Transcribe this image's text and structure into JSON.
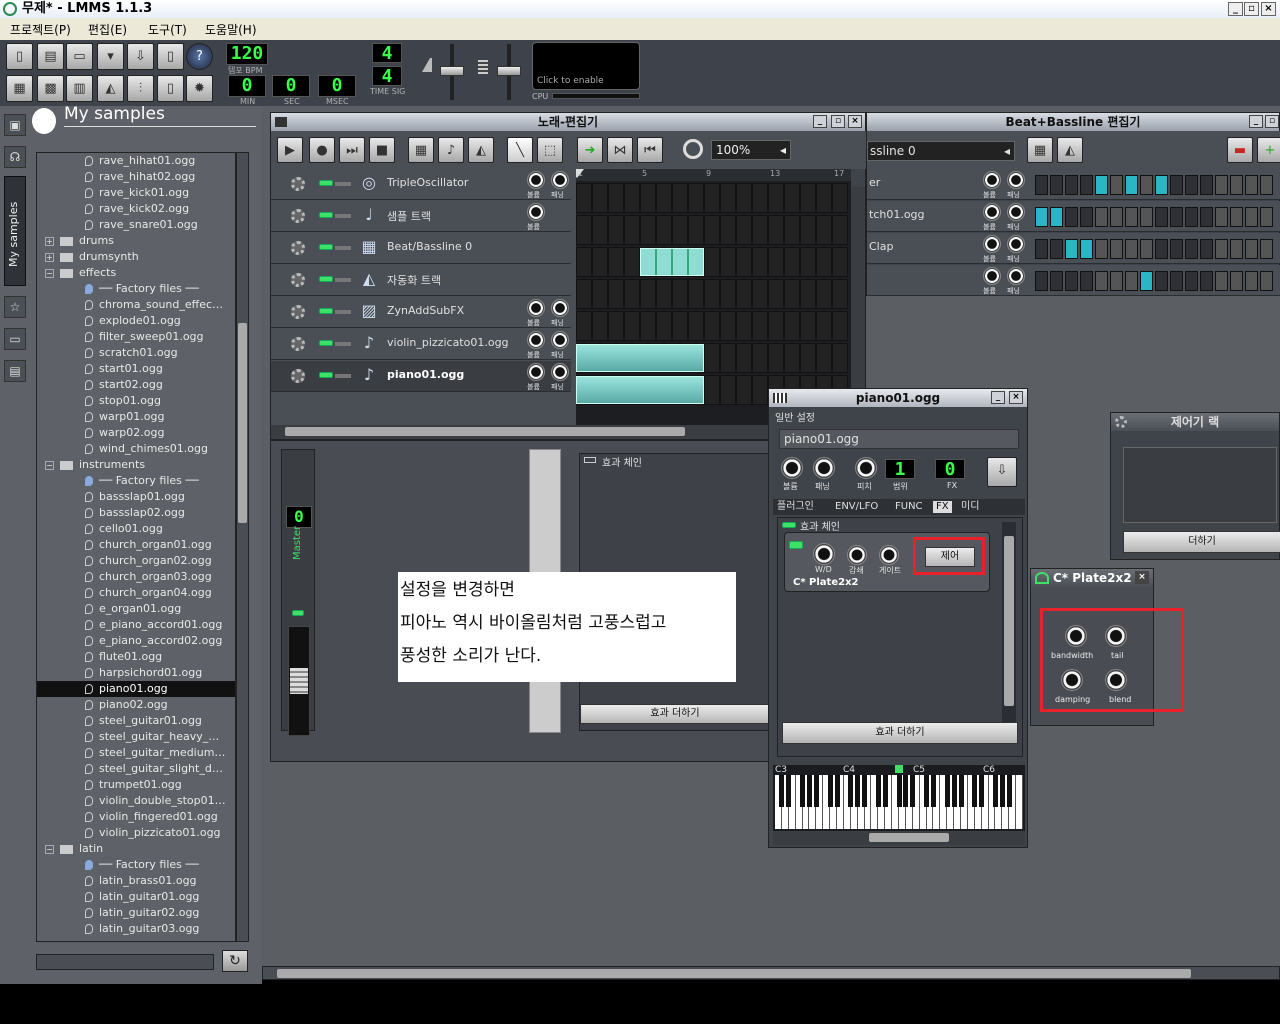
{
  "app": {
    "title": "무제* - LMMS 1.1.3",
    "win_min": "_",
    "win_max": "▫",
    "win_close": "×"
  },
  "menu": [
    "프로젝트(P)",
    "편집(E)",
    "도구(T)",
    "도움말(H)"
  ],
  "transport": {
    "tempo": "120",
    "tempo_label": "템포 BPM",
    "min": "0",
    "min_label": "MIN",
    "sec": "0",
    "sec_label": "SEC",
    "msec": "0",
    "msec_label": "MSEC",
    "ts_num": "4",
    "ts_den": "4",
    "ts_label": "TIME SIG",
    "cpu_text": "Click to enable",
    "cpu_label": "CPU"
  },
  "sidebar": {
    "heading": "My samples",
    "tab_label": "My samples",
    "items": [
      {
        "label": "rave_hihat01.ogg",
        "kind": "file",
        "depth": 2
      },
      {
        "label": "rave_hihat02.ogg",
        "kind": "file",
        "depth": 2
      },
      {
        "label": "rave_kick01.ogg",
        "kind": "file",
        "depth": 2
      },
      {
        "label": "rave_kick02.ogg",
        "kind": "file",
        "depth": 2
      },
      {
        "label": "rave_snare01.ogg",
        "kind": "file",
        "depth": 2
      },
      {
        "label": "drums",
        "kind": "folder",
        "depth": 1,
        "exp": "+"
      },
      {
        "label": "drumsynth",
        "kind": "folder",
        "depth": 1,
        "exp": "+"
      },
      {
        "label": "effects",
        "kind": "folder",
        "depth": 1,
        "exp": "-"
      },
      {
        "label": "── Factory files ──",
        "kind": "header",
        "depth": 2
      },
      {
        "label": "chroma_sound_effec…",
        "kind": "file",
        "depth": 2
      },
      {
        "label": "explode01.ogg",
        "kind": "file",
        "depth": 2
      },
      {
        "label": "filter_sweep01.ogg",
        "kind": "file",
        "depth": 2
      },
      {
        "label": "scratch01.ogg",
        "kind": "file",
        "depth": 2
      },
      {
        "label": "start01.ogg",
        "kind": "file",
        "depth": 2
      },
      {
        "label": "start02.ogg",
        "kind": "file",
        "depth": 2
      },
      {
        "label": "stop01.ogg",
        "kind": "file",
        "depth": 2
      },
      {
        "label": "warp01.ogg",
        "kind": "file",
        "depth": 2
      },
      {
        "label": "warp02.ogg",
        "kind": "file",
        "depth": 2
      },
      {
        "label": "wind_chimes01.ogg",
        "kind": "file",
        "depth": 2
      },
      {
        "label": "instruments",
        "kind": "folder",
        "depth": 1,
        "exp": "-"
      },
      {
        "label": "── Factory files ──",
        "kind": "header",
        "depth": 2
      },
      {
        "label": "bassslap01.ogg",
        "kind": "file",
        "depth": 2
      },
      {
        "label": "bassslap02.ogg",
        "kind": "file",
        "depth": 2
      },
      {
        "label": "cello01.ogg",
        "kind": "file",
        "depth": 2
      },
      {
        "label": "church_organ01.ogg",
        "kind": "file",
        "depth": 2
      },
      {
        "label": "church_organ02.ogg",
        "kind": "file",
        "depth": 2
      },
      {
        "label": "church_organ03.ogg",
        "kind": "file",
        "depth": 2
      },
      {
        "label": "church_organ04.ogg",
        "kind": "file",
        "depth": 2
      },
      {
        "label": "e_organ01.ogg",
        "kind": "file",
        "depth": 2
      },
      {
        "label": "e_piano_accord01.ogg",
        "kind": "file",
        "depth": 2
      },
      {
        "label": "e_piano_accord02.ogg",
        "kind": "file",
        "depth": 2
      },
      {
        "label": "flute01.ogg",
        "kind": "file",
        "depth": 2
      },
      {
        "label": "harpsichord01.ogg",
        "kind": "file",
        "depth": 2
      },
      {
        "label": "piano01.ogg",
        "kind": "file",
        "depth": 2,
        "selected": true
      },
      {
        "label": "piano02.ogg",
        "kind": "file",
        "depth": 2
      },
      {
        "label": "steel_guitar01.ogg",
        "kind": "file",
        "depth": 2
      },
      {
        "label": "steel_guitar_heavy_…",
        "kind": "file",
        "depth": 2
      },
      {
        "label": "steel_guitar_medium…",
        "kind": "file",
        "depth": 2
      },
      {
        "label": "steel_guitar_slight_d…",
        "kind": "file",
        "depth": 2
      },
      {
        "label": "trumpet01.ogg",
        "kind": "file",
        "depth": 2
      },
      {
        "label": "violin_double_stop01…",
        "kind": "file",
        "depth": 2
      },
      {
        "label": "violin_fingered01.ogg",
        "kind": "file",
        "depth": 2
      },
      {
        "label": "violin_pizzicato01.ogg",
        "kind": "file",
        "depth": 2
      },
      {
        "label": "latin",
        "kind": "folder",
        "depth": 1,
        "exp": "-"
      },
      {
        "label": "── Factory files ──",
        "kind": "header",
        "depth": 2
      },
      {
        "label": "latin_brass01.ogg",
        "kind": "file",
        "depth": 2
      },
      {
        "label": "latin_guitar01.ogg",
        "kind": "file",
        "depth": 2
      },
      {
        "label": "latin_guitar02.ogg",
        "kind": "file",
        "depth": 2
      },
      {
        "label": "latin_guitar03.ogg",
        "kind": "file",
        "depth": 2
      }
    ]
  },
  "song_editor": {
    "title": "노래-편집기",
    "zoom": "100%",
    "ruler": [
      "1",
      "5",
      "9",
      "13",
      "17"
    ],
    "tracks": [
      {
        "name": "TripleOscillator",
        "vol": "볼륨",
        "pan": "패닝",
        "bold": false
      },
      {
        "name": "샘플 트랙",
        "vol": "볼륨",
        "pan": "",
        "bold": false
      },
      {
        "name": "Beat/Bassline 0",
        "vol": "",
        "pan": "",
        "bold": false
      },
      {
        "name": "자동화 트랙",
        "vol": "",
        "pan": "",
        "bold": false
      },
      {
        "name": "ZynAddSubFX",
        "vol": "볼륨",
        "pan": "패닝",
        "bold": false
      },
      {
        "name": "violin_pizzicato01.ogg",
        "vol": "볼륨",
        "pan": "패닝",
        "bold": false
      },
      {
        "name": "piano01.ogg",
        "vol": "볼륨",
        "pan": "패닝",
        "bold": true
      }
    ]
  },
  "mixer": {
    "master_label": "Master",
    "value": "0",
    "fx_chain": "효과 체인",
    "add_effect": "효과 더하기"
  },
  "bb_editor": {
    "title": "Beat+Bassline 편집기",
    "selector": "ssline 0",
    "rows": [
      {
        "name": "er",
        "vol": "볼륨",
        "pan": "패닝"
      },
      {
        "name": "tch01.ogg",
        "vol": "볼륨",
        "pan": "패닝"
      },
      {
        "name": "Clap",
        "vol": "볼륨",
        "pan": "패닝"
      },
      {
        "name": "",
        "vol": "볼륨",
        "pan": "패닝"
      }
    ],
    "active": [
      [
        4,
        6,
        8
      ],
      [
        0,
        1
      ],
      [
        2,
        3
      ],
      [
        7
      ]
    ]
  },
  "instrument": {
    "title": "piano01.ogg",
    "section_general": "일반 설정",
    "name": "piano01.ogg",
    "vol": "볼륨",
    "pan": "패닝",
    "pitch": "피치",
    "range": "범위",
    "range_val": "1",
    "fx_label": "FX",
    "fx_val": "0",
    "tabs": [
      "플러그인",
      "ENV/LFO",
      "FUNC",
      "FX",
      "미디"
    ],
    "fx_chain": "효과 체인",
    "wd": "W/D",
    "decay": "감쇄",
    "gate": "게이트",
    "control_btn": "제어",
    "plugin_name": "C* Plate2x2",
    "add_effect": "효과 더하기",
    "keys": [
      "C3",
      "C4",
      "C5",
      "C6"
    ]
  },
  "controller_rack": {
    "title": "제어기 랙",
    "add": "더하기"
  },
  "plate_dialog": {
    "title": "C* Plate2x2",
    "knobs": [
      "bandwidth",
      "tail",
      "damping",
      "blend"
    ]
  },
  "annotation": {
    "line1": "설정을 변경하면",
    "line2": "피아노 역시 바이올림처럼 고풍스럽고",
    "line3": " 풍성한 소리가 난다."
  },
  "colors": {
    "pattern": "#8fdcd4",
    "highlight": "#e8222a",
    "lcd": "#39ff4a",
    "bb_active": "#2bb6c6"
  }
}
